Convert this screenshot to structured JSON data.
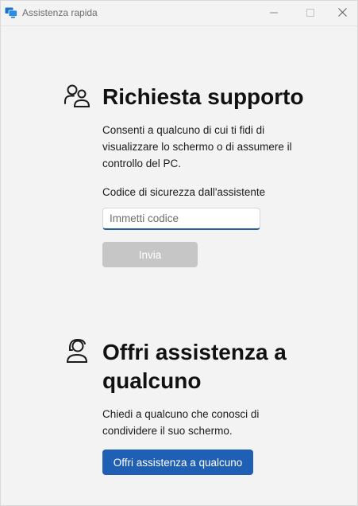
{
  "window": {
    "title": "Assistenza rapida",
    "app_icon": "quick-assist-monitor-icon",
    "controls": {
      "minimize_icon": "minimize-icon",
      "maximize_icon": "maximize-icon",
      "close_icon": "close-icon"
    }
  },
  "request_support": {
    "icon": "people-icon",
    "heading": "Richiesta supporto",
    "description": "Consenti a qualcuno di cui ti fidi di visualizzare lo schermo o di assumere il controllo del PC.",
    "code_label": "Codice di sicurezza dall'assistente",
    "code_value": "",
    "code_placeholder": "Immetti codice",
    "send_label": "Invia"
  },
  "offer_assistance": {
    "icon": "person-headset-icon",
    "heading": "Offri assistenza a qualcuno",
    "description": "Chiedi a qualcuno che conosci di condividere il suo schermo.",
    "button_label": "Offri assistenza a qualcuno"
  },
  "colors": {
    "background": "#f3f3f3",
    "accent": "#1f5fb4",
    "disabled_button": "#c6c6c6",
    "input_focus_border": "#1f5fa8"
  }
}
